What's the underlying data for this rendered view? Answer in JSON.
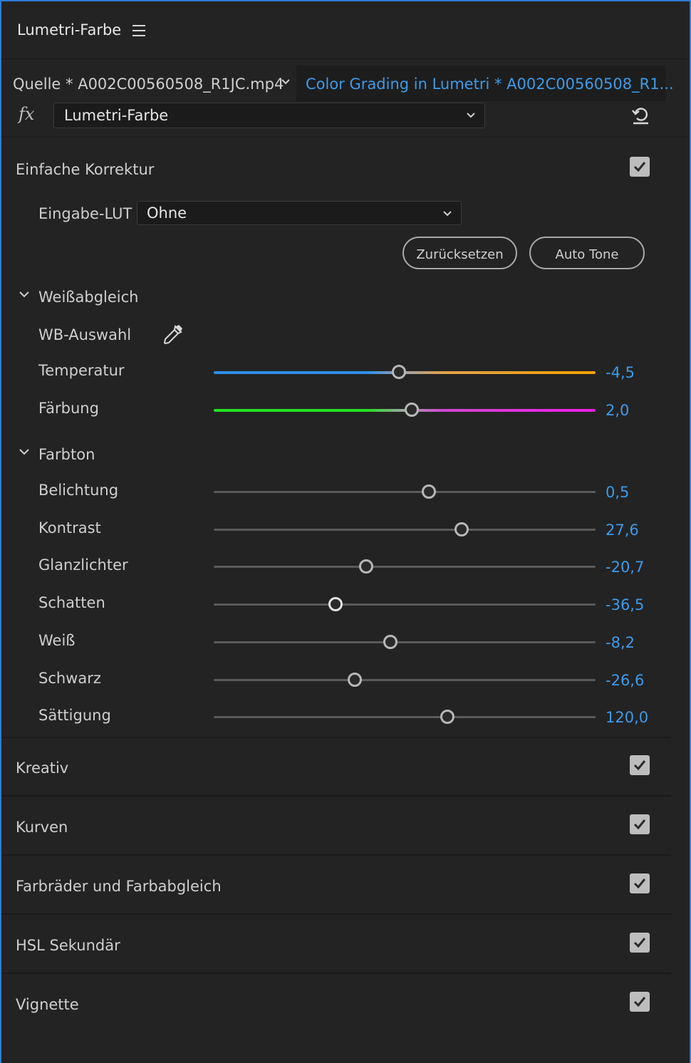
{
  "panel": {
    "title": "Lumetri-Farbe"
  },
  "source": {
    "clip_label": "Quelle * A002C00560508_R1JC.mp4",
    "sequence_label": "Color Grading in Lumetri * A002C00560508_R1..."
  },
  "effect": {
    "fx_symbol": "fx",
    "selected": "Lumetri-Farbe"
  },
  "basic": {
    "title": "Einfache Korrektur",
    "enabled": true,
    "lut_label": "Eingabe-LUT",
    "lut_value": "Ohne",
    "reset_label": "Zurücksetzen",
    "auto_tone_label": "Auto Tone"
  },
  "white_balance": {
    "title": "Weißabgleich",
    "picker_label": "WB-Auswahl",
    "sliders": [
      {
        "label": "Temperatur",
        "value": "-4,5",
        "fraction": 0.485
      },
      {
        "label": "Färbung",
        "value": "2,0",
        "fraction": 0.519
      }
    ]
  },
  "tone": {
    "title": "Farbton",
    "sliders": [
      {
        "label": "Belichtung",
        "value": "0,5",
        "fraction": 0.563
      },
      {
        "label": "Kontrast",
        "value": "27,6",
        "fraction": 0.649
      },
      {
        "label": "Glanzlichter",
        "value": "-20,7",
        "fraction": 0.399
      },
      {
        "label": "Schatten",
        "value": "-36,5",
        "fraction": 0.319
      },
      {
        "label": "Weiß",
        "value": "-8,2",
        "fraction": 0.463
      },
      {
        "label": "Schwarz",
        "value": "-26,6",
        "fraction": 0.369
      },
      {
        "label": "Sättigung",
        "value": "120,0",
        "fraction": 0.612
      }
    ]
  },
  "sections": [
    {
      "title": "Kreativ",
      "enabled": true
    },
    {
      "title": "Kurven",
      "enabled": true
    },
    {
      "title": "Farbräder und Farbabgleich",
      "enabled": true
    },
    {
      "title": "HSL Sekundär",
      "enabled": true
    },
    {
      "title": "Vignette",
      "enabled": true
    }
  ],
  "colors": {
    "accent_blue": "#3d9be9",
    "panel_bg": "#232323",
    "focus_border": "#2f7bd6"
  }
}
